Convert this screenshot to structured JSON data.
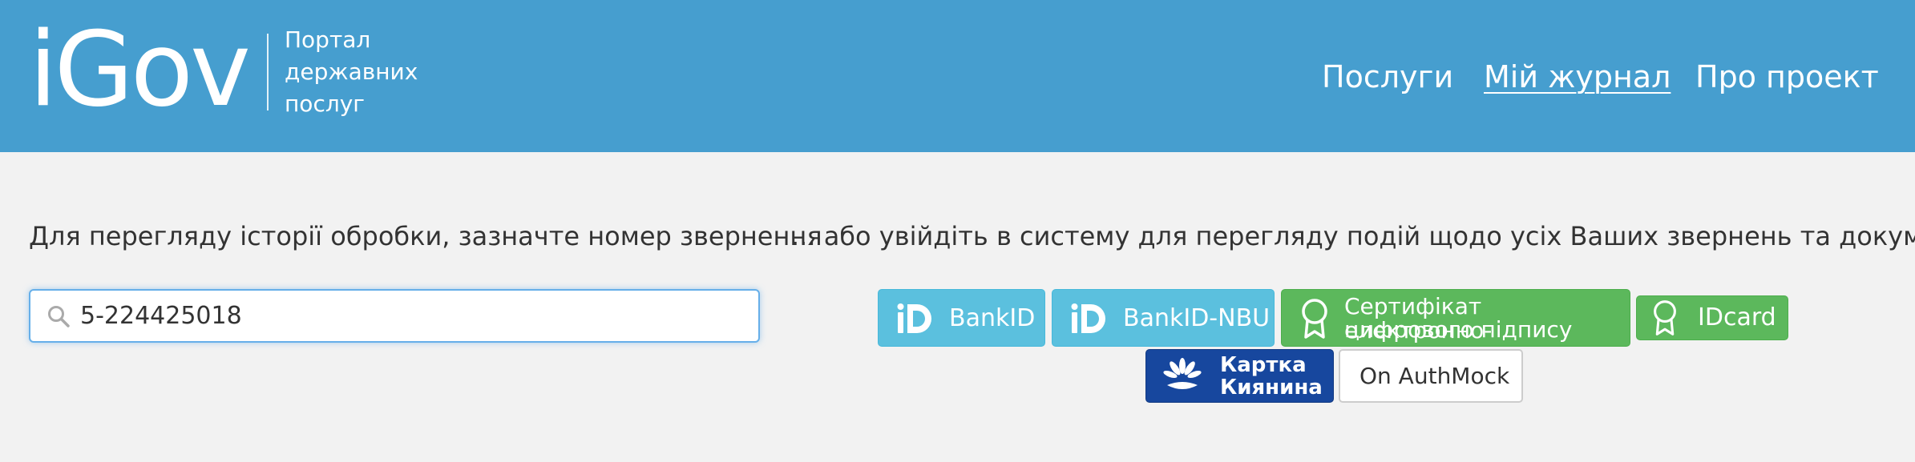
{
  "header": {
    "logo": "iGov",
    "tagline": [
      "Портал",
      "державних",
      "послуг"
    ],
    "nav": [
      {
        "label": "Послуги",
        "active": false
      },
      {
        "label": "Мій журнал",
        "active": true
      },
      {
        "label": "Про проект",
        "active": false
      }
    ]
  },
  "main": {
    "left_label": "Для перегляду історії обробки, зазначте номер звернення",
    "right_label": "... або увійдіть в систему для перегляду подій щодо усіх Ваших звернень та документів",
    "search": {
      "value": "5-224425018",
      "placeholder": ""
    },
    "auth_buttons": {
      "bankid": "BankID",
      "bankid_nbu": "BankID-NBU",
      "cert_line1": "Сертифікат електронно-",
      "cert_line2": "цифрового підпису",
      "idcard": "IDcard",
      "kyiv_line1": "Картка",
      "kyiv_line2": "Киянина",
      "authmock": "On AuthMock"
    }
  },
  "colors": {
    "header_bg": "#469ecf",
    "page_bg": "#f2f2f2",
    "info_btn": "#5bc0de",
    "success_btn": "#5cb85c",
    "kyiv_btn": "#17479e",
    "input_focus": "#66afe9"
  },
  "icons": {
    "search": "search-icon",
    "bankid": "bankid-logo-icon",
    "cert": "award-ribbon-icon",
    "kyiv": "chestnut-flower-icon"
  }
}
